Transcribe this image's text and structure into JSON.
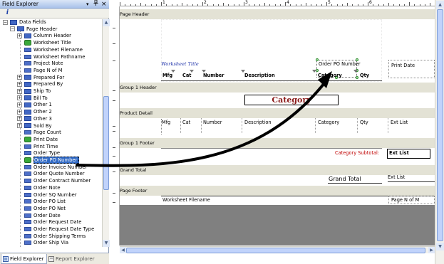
{
  "left_pane": {
    "title": "Field Explorer",
    "title_controls": {
      "pin": "▾",
      "autohide": "🖈",
      "close": "×"
    },
    "toolbar": {
      "info_icon_glyph": "i"
    },
    "tree": [
      {
        "label": "Data Fields",
        "level": 0,
        "expander": "−",
        "icon": "folder-icon"
      },
      {
        "label": "Page Header",
        "level": 1,
        "expander": "−",
        "icon": "folder-icon"
      },
      {
        "label": "Column Header",
        "level": 2,
        "expander": "+",
        "icon": "folder-icon"
      },
      {
        "label": "Worksheet Title",
        "level": 2,
        "expander": "",
        "icon": "check-field-icon"
      },
      {
        "label": "Worksheet Filename",
        "level": 2,
        "expander": "",
        "icon": "field-icon"
      },
      {
        "label": "Worksheet Pathname",
        "level": 2,
        "expander": "",
        "icon": "field-icon"
      },
      {
        "label": "Project Note",
        "level": 2,
        "expander": "",
        "icon": "field-icon"
      },
      {
        "label": "Page N of M",
        "level": 2,
        "expander": "",
        "icon": "field-icon"
      },
      {
        "label": "Prepared For",
        "level": 2,
        "expander": "+",
        "icon": "folder-icon"
      },
      {
        "label": "Prepared By",
        "level": 2,
        "expander": "+",
        "icon": "folder-icon"
      },
      {
        "label": "Ship To",
        "level": 2,
        "expander": "+",
        "icon": "folder-icon"
      },
      {
        "label": "Bill To",
        "level": 2,
        "expander": "+",
        "icon": "folder-icon"
      },
      {
        "label": "Other 1",
        "level": 2,
        "expander": "+",
        "icon": "folder-icon"
      },
      {
        "label": "Other 2",
        "level": 2,
        "expander": "+",
        "icon": "folder-icon"
      },
      {
        "label": "Other 3",
        "level": 2,
        "expander": "+",
        "icon": "folder-icon"
      },
      {
        "label": "Sold By",
        "level": 2,
        "expander": "+",
        "icon": "folder-icon"
      },
      {
        "label": "Page Count",
        "level": 2,
        "expander": "",
        "icon": "field-icon"
      },
      {
        "label": "Print Date",
        "level": 2,
        "expander": "",
        "icon": "check-field-icon"
      },
      {
        "label": "Print Time",
        "level": 2,
        "expander": "",
        "icon": "field-icon"
      },
      {
        "label": "Order Type",
        "level": 2,
        "expander": "",
        "icon": "field-icon"
      },
      {
        "label": "Order PO Number",
        "level": 2,
        "expander": "",
        "icon": "check-field-icon",
        "selected": true
      },
      {
        "label": "Order Invoice Number",
        "level": 2,
        "expander": "",
        "icon": "field-icon"
      },
      {
        "label": "Order Quote Number",
        "level": 2,
        "expander": "",
        "icon": "field-icon"
      },
      {
        "label": "Order Contract Number",
        "level": 2,
        "expander": "",
        "icon": "field-icon"
      },
      {
        "label": "Order Note",
        "level": 2,
        "expander": "",
        "icon": "field-icon"
      },
      {
        "label": "Order SQ Number",
        "level": 2,
        "expander": "",
        "icon": "field-icon"
      },
      {
        "label": "Order PO List",
        "level": 2,
        "expander": "",
        "icon": "field-icon"
      },
      {
        "label": "Order PO Net",
        "level": 2,
        "expander": "",
        "icon": "field-icon"
      },
      {
        "label": "Order Date",
        "level": 2,
        "expander": "",
        "icon": "field-icon"
      },
      {
        "label": "Order Request Date",
        "level": 2,
        "expander": "",
        "icon": "field-icon"
      },
      {
        "label": "Order Request Date Type",
        "level": 2,
        "expander": "",
        "icon": "field-icon"
      },
      {
        "label": "Order Shipping Terms",
        "level": 2,
        "expander": "",
        "icon": "field-icon"
      },
      {
        "label": "Order Ship Via",
        "level": 2,
        "expander": "",
        "icon": "field-icon"
      }
    ],
    "tabs": [
      {
        "label": "Field Explorer",
        "active": true
      },
      {
        "label": "Report Explorer",
        "active": false
      }
    ]
  },
  "ruler": {
    "numbers": [
      "1",
      "2",
      "3",
      "4",
      "5",
      "6"
    ]
  },
  "designer": {
    "page_header": {
      "band_label": "Page Header",
      "worksheet_title": "Worksheet Title",
      "order_po_number": "Order PO Number",
      "print_date": "Print Date",
      "columns": [
        "Mfg",
        "Cat",
        "Number",
        "Description",
        "Category",
        "Qty"
      ]
    },
    "group1_header": {
      "band_label": "Group 1 Header",
      "category": "Category"
    },
    "product_detail": {
      "band_label": "Product Detail",
      "columns": [
        "Mfg",
        "Cat",
        "Number",
        "Description",
        "Category",
        "Qty",
        "Ext List"
      ]
    },
    "group1_footer": {
      "band_label": "Group 1 Footer",
      "subtotal_label": "Category Subtotal:",
      "ext_list": "Ext List"
    },
    "grand_total": {
      "band_label": "Grand Total",
      "label": "Grand Total",
      "ext_list": "Ext List"
    },
    "page_footer": {
      "band_label": "Page Footer",
      "worksheet_filename": "Worksheet Filename",
      "page_n_of_m": "Page N of M"
    }
  },
  "colors": {
    "band_bg": "#e3e2d5",
    "category_title": "#8b1a1a",
    "subtotal_label": "#c00000",
    "worksheet_title": "#1b2fa8",
    "selection": "#316ac5",
    "gray_area": "#808080"
  }
}
